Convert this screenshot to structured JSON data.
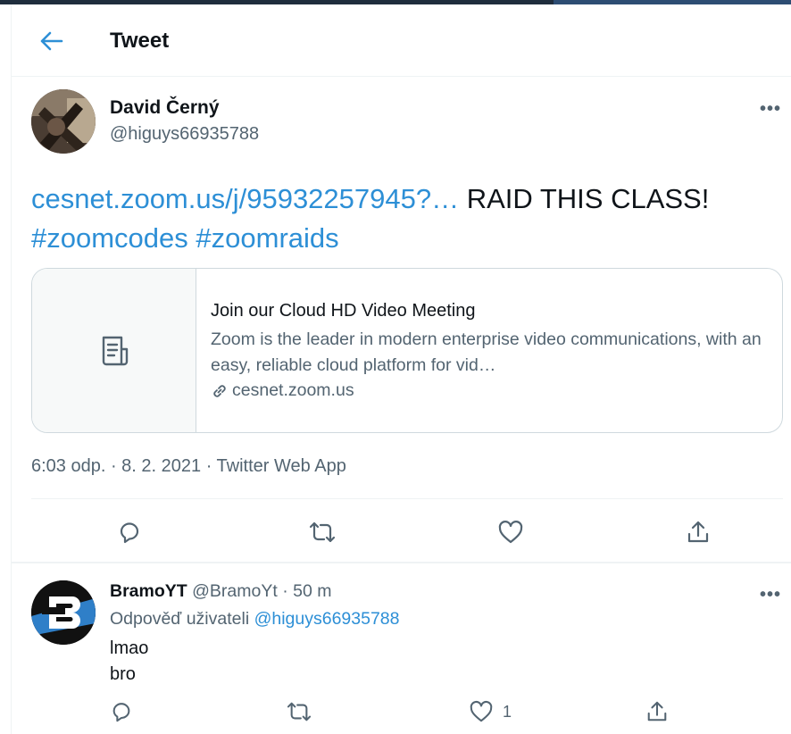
{
  "header": {
    "title": "Tweet"
  },
  "tweet": {
    "author_name": "David Černý",
    "author_handle": "@higuys66935788",
    "link_text": "cesnet.zoom.us/j/95932257945?…",
    "text": " RAID THIS CLASS!",
    "hashtag1": "#zoomcodes",
    "hashtag2": "#zoomraids",
    "card": {
      "title": "Join our Cloud HD Video Meeting",
      "description": "Zoom is the leader in modern enterprise video communications, with an easy, reliable cloud platform for vid…",
      "domain": "cesnet.zoom.us"
    },
    "meta": "6:03 odp. · 8. 2. 2021 · Twitter Web App"
  },
  "reply": {
    "author_name": "BramoYT",
    "author_handle": "@BramoYt",
    "time": "· 50 m",
    "replying_prefix": "Odpověď uživateli ",
    "replying_to": "@higuys66935788",
    "line1": "lmao",
    "line2": "bro",
    "like_count": "1"
  },
  "icons": {
    "back": "arrow-left-icon",
    "more": "more-horizontal-icon",
    "reply": "reply-icon",
    "retweet": "retweet-icon",
    "like": "heart-icon",
    "share": "share-icon",
    "card_thumb": "document-icon",
    "link": "link-icon"
  },
  "colors": {
    "accent": "#2d8fd6",
    "text": "#0f1419",
    "secondary": "#536471"
  }
}
